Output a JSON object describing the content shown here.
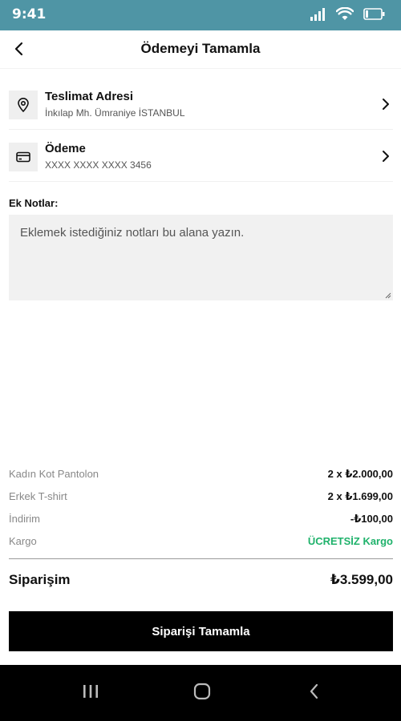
{
  "status_bar": {
    "time": "9:41",
    "icons": [
      "signal-icon",
      "wifi-icon",
      "battery-icon"
    ]
  },
  "header": {
    "title": "Ödemeyi Tamamla"
  },
  "delivery": {
    "title": "Teslimat Adresi",
    "subtitle": "İnkılap Mh. Ümraniye İSTANBUL"
  },
  "payment": {
    "title": "Ödeme",
    "subtitle": "XXXX XXXX XXXX 3456"
  },
  "notes": {
    "label": "Ek Notlar:",
    "placeholder": "Eklemek istediğiniz notları bu alana yazın."
  },
  "summary": {
    "items": [
      {
        "label": "Kadın Kot Pantolon",
        "value": "2 x ₺2.000,00"
      },
      {
        "label": "Erkek T-shirt",
        "value": "2 x ₺1.699,00"
      },
      {
        "label": "İndirim",
        "value": "-₺100,00"
      },
      {
        "label": "Kargo",
        "value": "ÜCRETSİZ Kargo"
      }
    ],
    "total_label": "Siparişim",
    "total_value": "₺3.599,00"
  },
  "cta": {
    "label": "Siparişi Tamamla"
  },
  "colors": {
    "status_bar": "#4f95a5",
    "button": "#000000",
    "free_shipping": "#1fb26b"
  }
}
